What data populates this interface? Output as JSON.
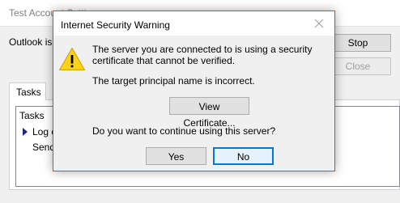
{
  "background_window": {
    "title": "Test Account Settings",
    "status_text": "Outlook is",
    "stop_label": "Stop",
    "close_label": "Close",
    "tab_label": "Tasks",
    "list_header": "Tasks",
    "items": [
      "Log o",
      "Send"
    ]
  },
  "dialog": {
    "title": "Internet Security Warning",
    "message_line1": "The server you are connected to is using a security certificate that cannot be verified.",
    "message_line2": "The target principal name is incorrect.",
    "view_certificate_label": "View Certificate...",
    "question": "Do you want to continue using this server?",
    "yes_label": "Yes",
    "no_label": "No",
    "icon": "warning-icon",
    "default_button": "No"
  },
  "colors": {
    "dialog_border": "#1883d7",
    "warning_yellow": "#fcd116",
    "focus_blue": "#0078d7"
  }
}
